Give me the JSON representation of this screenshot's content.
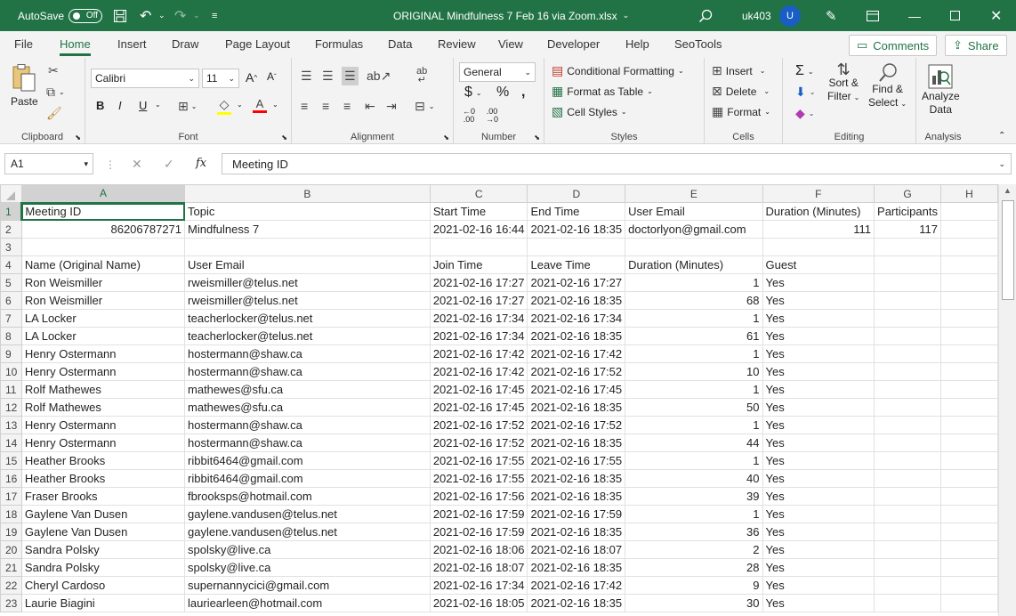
{
  "titlebar": {
    "autosave_label": "AutoSave",
    "autosave_state": "Off",
    "filename": "ORIGINAL Mindfulness 7 Feb 16 via Zoom.xlsx",
    "user_name": "uk403",
    "avatar_initial": "U"
  },
  "menu": {
    "tabs": [
      "File",
      "Home",
      "Insert",
      "Draw",
      "Page Layout",
      "Formulas",
      "Data",
      "Review",
      "View",
      "Developer",
      "Help",
      "SeoTools"
    ],
    "comments_label": "Comments",
    "share_label": "Share"
  },
  "ribbon": {
    "clipboard": {
      "label": "Clipboard",
      "paste": "Paste"
    },
    "font": {
      "label": "Font",
      "name": "Calibri",
      "size": "11"
    },
    "alignment": {
      "label": "Alignment"
    },
    "number": {
      "label": "Number",
      "format": "General"
    },
    "styles": {
      "label": "Styles",
      "conditional": "Conditional Formatting",
      "format_table": "Format as Table",
      "cell_styles": "Cell Styles"
    },
    "cells": {
      "label": "Cells",
      "insert": "Insert",
      "delete": "Delete",
      "format": "Format"
    },
    "editing": {
      "label": "Editing",
      "sort1": "Sort &",
      "sort2": "Filter",
      "find1": "Find &",
      "find2": "Select"
    },
    "analysis": {
      "label": "Analysis",
      "analyze1": "Analyze",
      "analyze2": "Data"
    }
  },
  "formula_bar": {
    "name_box": "A1",
    "value": "Meeting ID"
  },
  "columns": [
    "A",
    "B",
    "C",
    "D",
    "E",
    "F",
    "G",
    "H"
  ],
  "rows": [
    {
      "n": "1",
      "cells": [
        "Meeting ID",
        "Topic",
        "Start Time",
        "End Time",
        "User Email",
        "Duration (Minutes)",
        "Participants",
        ""
      ]
    },
    {
      "n": "2",
      "cells": [
        "86206787271",
        "Mindfulness 7",
        "2021-02-16 16:44",
        "2021-02-16 18:35",
        "doctorlyon@gmail.com",
        "111",
        "117",
        ""
      ]
    },
    {
      "n": "3",
      "cells": [
        "",
        "",
        "",
        "",
        "",
        "",
        "",
        ""
      ]
    },
    {
      "n": "4",
      "cells": [
        "Name (Original Name)",
        "User Email",
        "Join Time",
        "Leave Time",
        "Duration (Minutes)",
        "Guest",
        "",
        ""
      ]
    },
    {
      "n": "5",
      "cells": [
        "Ron Weismiller",
        "rweismiller@telus.net",
        "2021-02-16 17:27",
        "2021-02-16 17:27",
        "1",
        "Yes",
        "",
        ""
      ]
    },
    {
      "n": "6",
      "cells": [
        "Ron Weismiller",
        "rweismiller@telus.net",
        "2021-02-16 17:27",
        "2021-02-16 18:35",
        "68",
        "Yes",
        "",
        ""
      ]
    },
    {
      "n": "7",
      "cells": [
        "LA Locker",
        "teacherlocker@telus.net",
        "2021-02-16 17:34",
        "2021-02-16 17:34",
        "1",
        "Yes",
        "",
        ""
      ]
    },
    {
      "n": "8",
      "cells": [
        "LA Locker",
        "teacherlocker@telus.net",
        "2021-02-16 17:34",
        "2021-02-16 18:35",
        "61",
        "Yes",
        "",
        ""
      ]
    },
    {
      "n": "9",
      "cells": [
        "Henry Ostermann",
        "hostermann@shaw.ca",
        "2021-02-16 17:42",
        "2021-02-16 17:42",
        "1",
        "Yes",
        "",
        ""
      ]
    },
    {
      "n": "10",
      "cells": [
        "Henry Ostermann",
        "hostermann@shaw.ca",
        "2021-02-16 17:42",
        "2021-02-16 17:52",
        "10",
        "Yes",
        "",
        ""
      ]
    },
    {
      "n": "11",
      "cells": [
        "Rolf Mathewes",
        "mathewes@sfu.ca",
        "2021-02-16 17:45",
        "2021-02-16 17:45",
        "1",
        "Yes",
        "",
        ""
      ]
    },
    {
      "n": "12",
      "cells": [
        "Rolf Mathewes",
        "mathewes@sfu.ca",
        "2021-02-16 17:45",
        "2021-02-16 18:35",
        "50",
        "Yes",
        "",
        ""
      ]
    },
    {
      "n": "13",
      "cells": [
        "Henry Ostermann",
        "hostermann@shaw.ca",
        "2021-02-16 17:52",
        "2021-02-16 17:52",
        "1",
        "Yes",
        "",
        ""
      ]
    },
    {
      "n": "14",
      "cells": [
        "Henry Ostermann",
        "hostermann@shaw.ca",
        "2021-02-16 17:52",
        "2021-02-16 18:35",
        "44",
        "Yes",
        "",
        ""
      ]
    },
    {
      "n": "15",
      "cells": [
        "Heather Brooks",
        "ribbit6464@gmail.com",
        "2021-02-16 17:55",
        "2021-02-16 17:55",
        "1",
        "Yes",
        "",
        ""
      ]
    },
    {
      "n": "16",
      "cells": [
        "Heather Brooks",
        "ribbit6464@gmail.com",
        "2021-02-16 17:55",
        "2021-02-16 18:35",
        "40",
        "Yes",
        "",
        ""
      ]
    },
    {
      "n": "17",
      "cells": [
        "Fraser Brooks",
        "fbrooksps@hotmail.com",
        "2021-02-16 17:56",
        "2021-02-16 18:35",
        "39",
        "Yes",
        "",
        ""
      ]
    },
    {
      "n": "18",
      "cells": [
        "Gaylene Van Dusen",
        "gaylene.vandusen@telus.net",
        "2021-02-16 17:59",
        "2021-02-16 17:59",
        "1",
        "Yes",
        "",
        ""
      ]
    },
    {
      "n": "19",
      "cells": [
        "Gaylene Van Dusen",
        "gaylene.vandusen@telus.net",
        "2021-02-16 17:59",
        "2021-02-16 18:35",
        "36",
        "Yes",
        "",
        ""
      ]
    },
    {
      "n": "20",
      "cells": [
        "Sandra Polsky",
        "spolsky@live.ca",
        "2021-02-16 18:06",
        "2021-02-16 18:07",
        "2",
        "Yes",
        "",
        ""
      ]
    },
    {
      "n": "21",
      "cells": [
        "Sandra Polsky",
        "spolsky@live.ca",
        "2021-02-16 18:07",
        "2021-02-16 18:35",
        "28",
        "Yes",
        "",
        ""
      ]
    },
    {
      "n": "22",
      "cells": [
        "Cheryl Cardoso",
        "supernannycici@gmail.com",
        "2021-02-16 17:34",
        "2021-02-16 17:42",
        "9",
        "Yes",
        "",
        ""
      ]
    },
    {
      "n": "23",
      "cells": [
        "Laurie Biagini",
        "lauriearleen@hotmail.com",
        "2021-02-16 18:05",
        "2021-02-16 18:35",
        "30",
        "Yes",
        "",
        ""
      ]
    }
  ],
  "icons": {
    "search": "search-icon",
    "save": "save-icon",
    "undo": "undo-icon",
    "redo": "redo-icon",
    "pen": "pen-icon",
    "ribbon_display": "ribbon-display-icon",
    "minimize": "minimize-icon",
    "maximize": "maximize-icon",
    "close": "close-icon"
  },
  "colors": {
    "brand": "#217346",
    "avatar": "#1a5ec4"
  }
}
